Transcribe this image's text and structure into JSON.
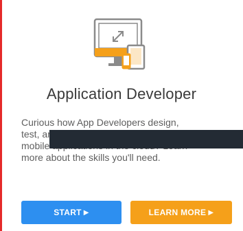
{
  "card": {
    "title": "Application Developer",
    "description_line1": "Curious how App Developers design,",
    "description_line2": "test, ar",
    "description_line3": "mobile applications in the cloud? Learn",
    "description_line4": "more about the skills you'll need."
  },
  "buttons": {
    "start_label": "START",
    "learn_more_label": "LEARN MORE",
    "arrow_glyph": "▶"
  },
  "icon": "devices-icon",
  "colors": {
    "accent_orange": "#f5a01a",
    "start_blue": "#2d8ff0",
    "border_red": "#e52a2a",
    "redaction": "#232b34"
  }
}
